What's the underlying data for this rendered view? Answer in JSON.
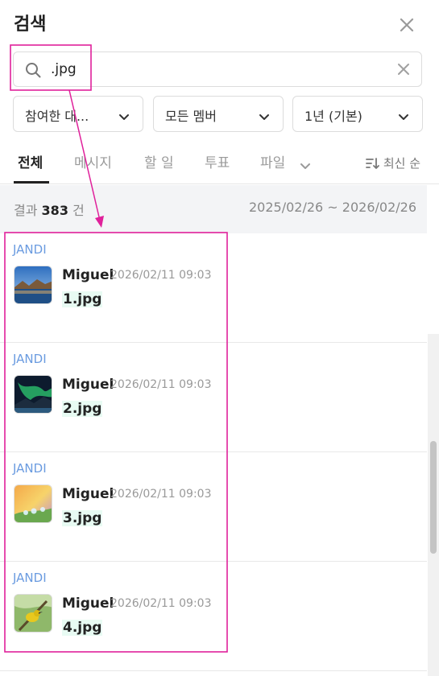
{
  "header": {
    "title": "검색"
  },
  "search": {
    "value": ".jpg"
  },
  "filters": [
    {
      "label": "참여한 대..."
    },
    {
      "label": "모든 멤버"
    },
    {
      "label": "1년 (기본)"
    }
  ],
  "tabs": [
    {
      "label": "전체",
      "active": true
    },
    {
      "label": "메시지"
    },
    {
      "label": "할 일"
    },
    {
      "label": "투표"
    },
    {
      "label": "파일"
    }
  ],
  "sort": {
    "label": "최신 순"
  },
  "summary": {
    "prefix": "결과",
    "count": "383",
    "suffix": "건",
    "date_range": "2025/02/26 ~ 2026/02/26"
  },
  "results": [
    {
      "team": "JANDI",
      "author": "Miguel",
      "time": "2026/02/11 09:03",
      "file": "1.jpg",
      "thumb": "lake-landscape"
    },
    {
      "team": "JANDI",
      "author": "Miguel",
      "time": "2026/02/11 09:03",
      "file": "2.jpg",
      "thumb": "aurora"
    },
    {
      "team": "JANDI",
      "author": "Miguel",
      "time": "2026/02/11 09:03",
      "file": "3.jpg",
      "thumb": "water-drops-flowers"
    },
    {
      "team": "JANDI",
      "author": "Miguel",
      "time": "2026/02/11 09:03",
      "file": "4.jpg",
      "thumb": "yellow-bird"
    }
  ],
  "colors": {
    "accent_team": "#6a9be0",
    "annotation": "#e0219b",
    "file_highlight": "#e8fbf3"
  }
}
